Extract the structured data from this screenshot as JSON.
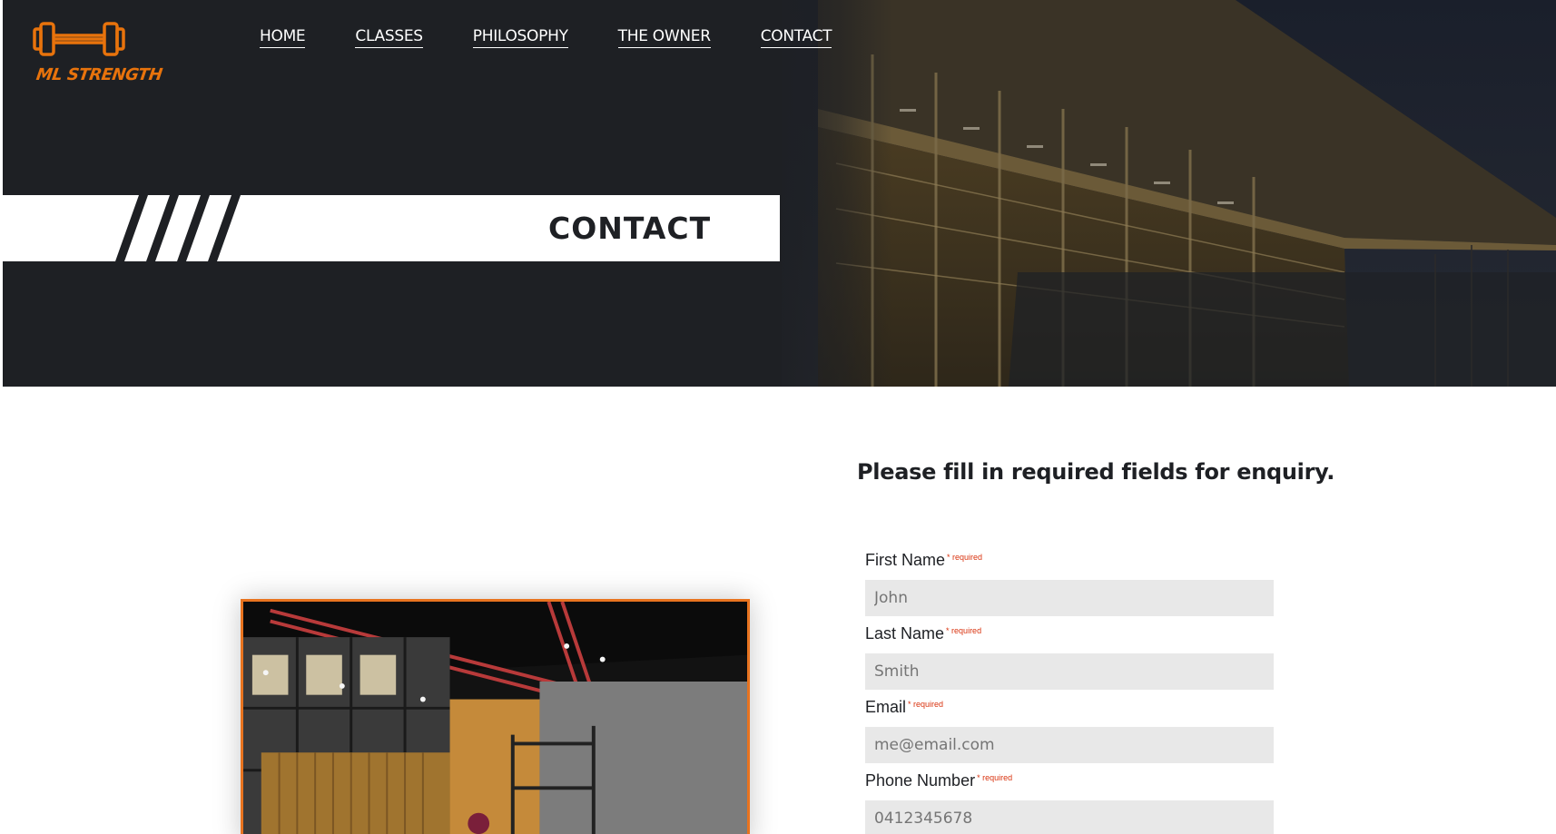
{
  "brand": {
    "name": "ML STRENGTH",
    "accent_color": "#e8730c"
  },
  "nav": {
    "items": [
      {
        "label": "HOME"
      },
      {
        "label": "CLASSES"
      },
      {
        "label": "PHILOSOPHY"
      },
      {
        "label": "THE OWNER"
      },
      {
        "label": "CONTACT"
      }
    ]
  },
  "hero": {
    "title": "CONTACT"
  },
  "form": {
    "heading": "Please fill in required fields for enquiry.",
    "required_marker": "* required",
    "fields": [
      {
        "label": "First Name",
        "placeholder": "John"
      },
      {
        "label": "Last Name",
        "placeholder": "Smith"
      },
      {
        "label": "Email",
        "placeholder": "me@email.com"
      },
      {
        "label": "Phone Number",
        "placeholder": "0412345678"
      }
    ]
  },
  "colors": {
    "hero_background": "#1e2024",
    "card_border": "#e8731f",
    "required": "#d9330f",
    "input_background": "#e8e8e8"
  }
}
